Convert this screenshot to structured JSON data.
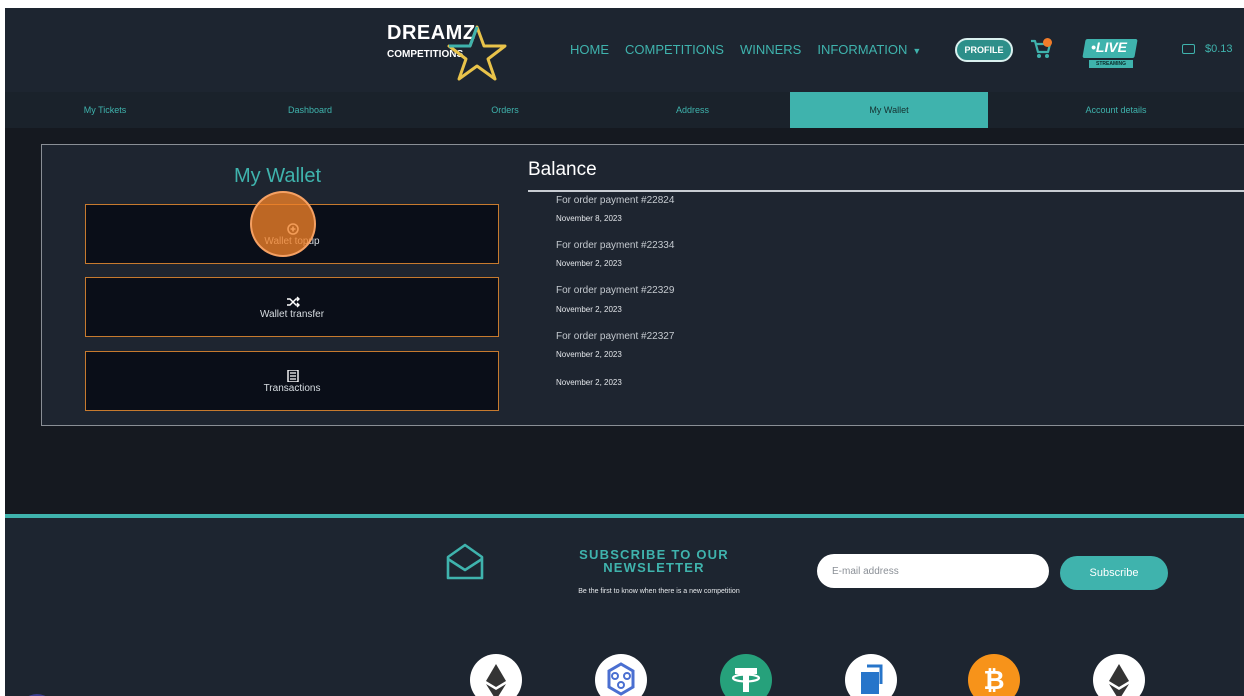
{
  "header": {
    "logo": {
      "line1": "DREAMZ",
      "line2": "COMPETITIONS"
    },
    "nav": [
      {
        "label": "HOME"
      },
      {
        "label": "COMPETITIONS"
      },
      {
        "label": "WINNERS"
      },
      {
        "label": "INFORMATION"
      }
    ],
    "profile_label": "PROFILE",
    "live": {
      "label": "•LIVE",
      "sub": "STREAMING"
    },
    "wallet_amount": "$0.13"
  },
  "tabs": [
    {
      "label": "My Tickets",
      "active": false
    },
    {
      "label": "Dashboard",
      "active": false
    },
    {
      "label": "Orders",
      "active": false
    },
    {
      "label": "Address",
      "active": false
    },
    {
      "label": "My Wallet",
      "active": true
    },
    {
      "label": "Account details",
      "active": false
    }
  ],
  "wallet": {
    "title": "My Wallet",
    "buttons": [
      {
        "label": "Wallet topup",
        "icon": "plus-circle-icon"
      },
      {
        "label": "Wallet transfer",
        "icon": "shuffle-icon"
      },
      {
        "label": "Transactions",
        "icon": "list-icon"
      }
    ]
  },
  "balance": {
    "title": "Balance",
    "transactions": [
      {
        "desc": "For order payment #22824",
        "date": "November 8, 2023"
      },
      {
        "desc": "For order payment #22334",
        "date": "November 2, 2023"
      },
      {
        "desc": "For order payment #22329",
        "date": "November 2, 2023"
      },
      {
        "desc": "For order payment #22327",
        "date": "November 2, 2023"
      },
      {
        "desc": "",
        "date": "November 2, 2023"
      }
    ]
  },
  "newsletter": {
    "title": "SUBSCRIBE TO OUR NEWSLETTER",
    "subtitle": "Be the first to know when there is a new competition",
    "email_placeholder": "E-mail address",
    "subscribe_label": "Subscribe"
  },
  "payment_icons": [
    "ethereum-icon",
    "chainlink-icon",
    "tether-icon",
    "usdc-icon",
    "bitcoin-icon",
    "ethereum-icon"
  ],
  "colors": {
    "accent": "#3fb3ad",
    "button_border": "#c77a2e",
    "click_marker": "#f08028",
    "background": "#161a21"
  }
}
